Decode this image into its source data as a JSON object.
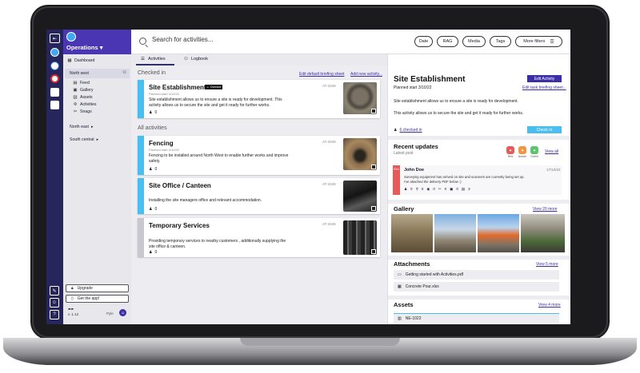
{
  "app": {
    "name": "Operations"
  },
  "sidebar": {
    "dashboard": "Dashboard",
    "region": "North west",
    "items": [
      "Feed",
      "Gallery",
      "Assets",
      "Activities",
      "Snags"
    ],
    "regions": [
      "North east",
      "South central"
    ],
    "upgrade": "Upgrade",
    "get_app": "Get the app!",
    "version": "v. 1.12",
    "user": "Pyle"
  },
  "header": {
    "search_placeholder": "Search for activities...",
    "filters": [
      "Date",
      "RAG",
      "Media",
      "Tags",
      "More filters"
    ]
  },
  "tabs": [
    {
      "label": "Activities",
      "active": true
    },
    {
      "label": "Logbook",
      "active": false
    }
  ],
  "list": {
    "checked_in_title": "Checked in",
    "edit_default_sheet": "Edit default briefing sheet",
    "add_new_activity": "Add new activity...",
    "all_activities_title": "All activities",
    "checked_in": [
      {
        "title": "Site Establishment",
        "badge": "Overdue",
        "planned": "Planned start 3/10/22",
        "description": "Site establishment allows us to ensure a site is ready for development. This activity allows us to secure the site and get it ready for further works.",
        "id": "AT-2349",
        "people": "0",
        "color": "#4bbef0"
      }
    ],
    "activities": [
      {
        "title": "Fencing",
        "planned": "Planned start 3/10/22",
        "description": "Fencing to be installed around North West to enable further works and improve safety.",
        "id": "AT-2349",
        "people": "0",
        "color": "#4bbef0"
      },
      {
        "title": "Site Office / Canteen",
        "planned": "",
        "description": "Installing the site managers office and relevant accommodation.",
        "id": "AT-2349",
        "people": "0",
        "color": "#4bbef0"
      },
      {
        "title": "Temporary Services",
        "planned": "",
        "description": "Providing temporary services to nearby customers , additionally supplying the site office & canteen.",
        "id": "AT-2349",
        "people": "0",
        "color": "#c8c8d0"
      }
    ]
  },
  "detail": {
    "title": "Site Establishment",
    "planned": "Planned start 3/10/22",
    "edit_activity": "Edit Activity",
    "edit_briefing": "Edit task briefing sheet...",
    "desc1": "Site establishment allows us to ensure a site is ready for development.",
    "desc2": "This activity allows us to secure the site and get it ready for further works.",
    "checked_in_link": "6 checked in",
    "checkin_button": "Check In",
    "recent_updates": "Recent updates",
    "latest_post": "Latest post",
    "view_all": "View all",
    "rag": [
      {
        "label": "Red",
        "color": "#e85a5a"
      },
      {
        "label": "Amber",
        "color": "#f3953f"
      },
      {
        "label": "Green",
        "color": "#5cc46a"
      }
    ],
    "update": {
      "status": "Red",
      "author": "John Doe",
      "date": "17/10/22",
      "text1": "Surveying equipment has arrived on site and scanners are currently being set up.",
      "text2": "I've attached the delivery PDF below :)",
      "stats": [
        "0",
        "0",
        "0",
        "0",
        "0",
        "3"
      ]
    },
    "gallery_title": "Gallery",
    "gallery_link": "View 20 more",
    "attachments_title": "Attachments",
    "attachments_link": "View 5 more",
    "attachments": [
      "Getting started with Activities.pdf",
      "Concrete Pour.xlsx"
    ],
    "assets_title": "Assets",
    "assets_link": "View 4 more",
    "asset": "NE-1022"
  }
}
